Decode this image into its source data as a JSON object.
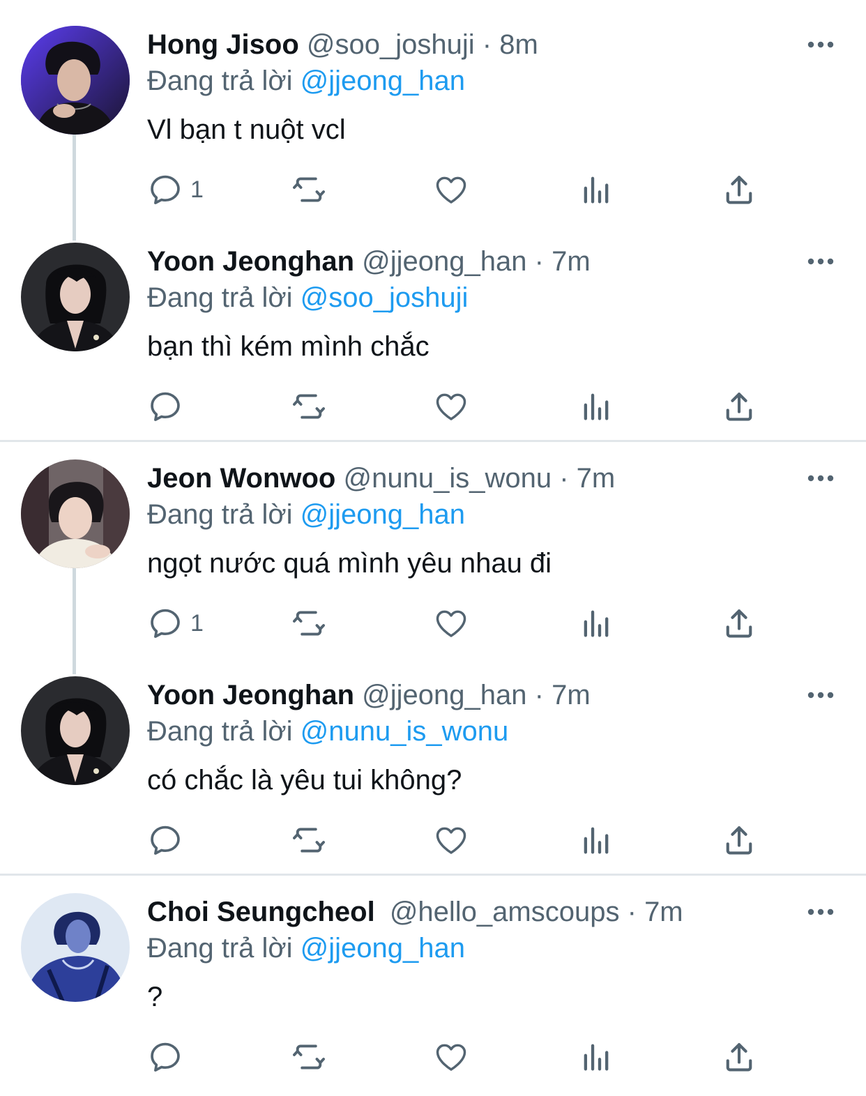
{
  "colors": {
    "text_primary": "#0f1419",
    "text_secondary": "#536471",
    "mention": "#1d9bf0",
    "thread_line": "#cfd9de",
    "divider": "#e1e6ea"
  },
  "reply_prefix": "Đang trả lời",
  "separator": "·",
  "tweets": [
    {
      "display_name": "Hong Jisoo",
      "handle": "@soo_joshuji",
      "time": "8m",
      "replying_to": "@jjeong_han",
      "text": "Vl bạn t nuột vcl",
      "reply_count": "1",
      "avatar": "avatar-purple-portrait"
    },
    {
      "display_name": "Yoon Jeonghan",
      "handle": "@jjeong_han",
      "time": "7m",
      "replying_to": "@soo_joshuji",
      "text": "bạn thì kém mình chắc",
      "reply_count": "",
      "avatar": "avatar-dark-portrait"
    },
    {
      "display_name": "Jeon Wonwoo",
      "handle": "@nunu_is_wonu",
      "time": "7m",
      "replying_to": "@jjeong_han",
      "text": "ngọt nước quá mình yêu nhau đi",
      "reply_count": "1",
      "avatar": "avatar-light-portrait"
    },
    {
      "display_name": "Yoon Jeonghan",
      "handle": "@jjeong_han",
      "time": "7m",
      "replying_to": "@nunu_is_wonu",
      "text": "có chắc là yêu tui không?",
      "reply_count": "",
      "avatar": "avatar-dark-portrait"
    },
    {
      "display_name": "Choi Seungcheol",
      "handle": "@hello_amscoups",
      "time": "7m",
      "replying_to": "@jjeong_han",
      "text": "?",
      "reply_count": "",
      "avatar": "avatar-blue-portrait"
    }
  ]
}
